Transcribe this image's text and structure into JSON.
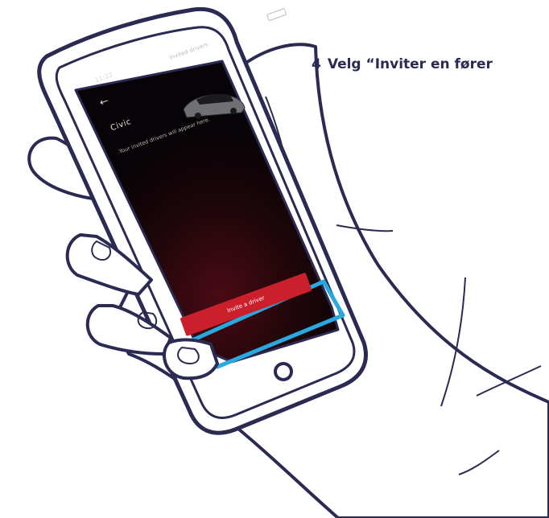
{
  "instruction": {
    "step_number": "4",
    "text": "Velg “Inviter en fører"
  },
  "phone": {
    "status_time": "11:22",
    "header_title": "Invited drivers",
    "back_glyph": "←",
    "brand": "Civic",
    "empty_message": "Your invited drivers will appear here.",
    "invite_button_label": "Invite a driver"
  },
  "colors": {
    "outline": "#2a2a52",
    "highlight": "#29a9e0",
    "button_red": "#cc1f2c",
    "screen_dark": "#0b0509"
  },
  "icons": [
    "hand-illustration",
    "car-image",
    "home-button-icon",
    "battery-icon",
    "back-arrow-icon"
  ]
}
